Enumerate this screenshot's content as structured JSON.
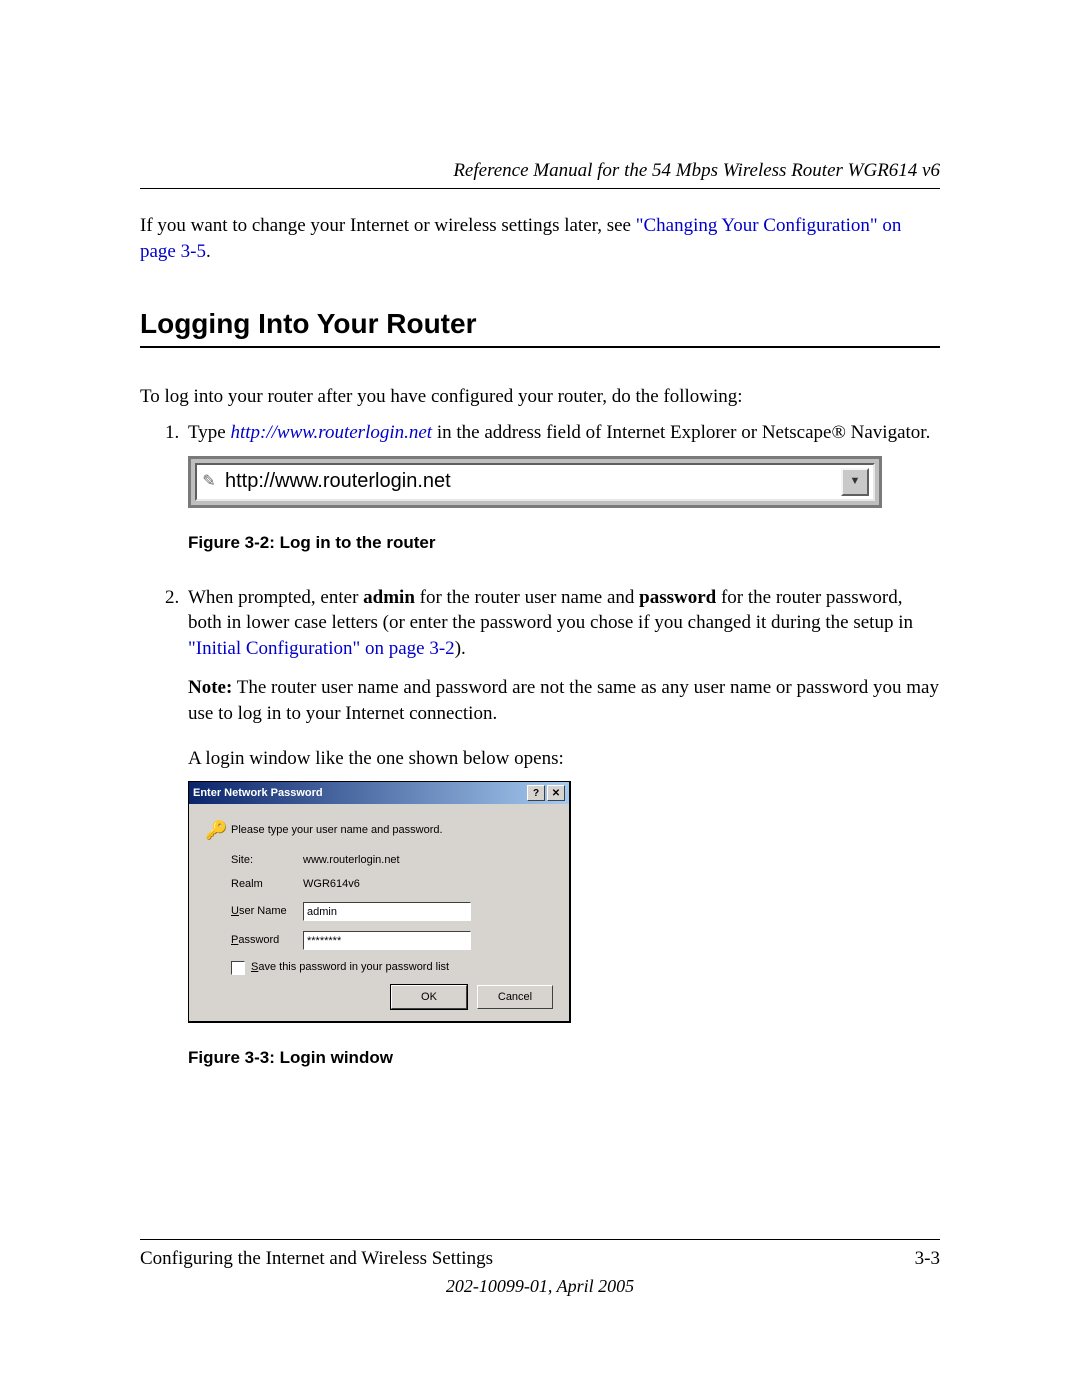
{
  "header": {
    "title": "Reference Manual for the 54 Mbps Wireless Router WGR614 v6"
  },
  "intro": {
    "pre": "If you want to change your Internet or wireless settings later, see ",
    "link": "\"Changing Your Configuration\" on page 3-5",
    "post": "."
  },
  "heading": "Logging Into Your Router",
  "lead": "To log into your router after you have configured your router, do the following:",
  "step1": {
    "pre": "Type ",
    "url": "http://www.routerlogin.net",
    "post": " in the address field of Internet Explorer or Netscape® Navigator."
  },
  "address_bar": {
    "text": "http://www.routerlogin.net"
  },
  "fig32_caption": "Figure 3-2:  Log in to the router",
  "step2": {
    "part1_pre": "When prompted, enter ",
    "bold1": "admin",
    "part1_mid": " for the router user name and ",
    "bold2": "password",
    "part1_post": " for the router password, both in lower case letters (or enter the password you chose if you changed it during the setup in ",
    "link": "\"Initial Configuration\" on page 3-2",
    "part1_end": ").",
    "note_label": "Note:",
    "note_text": " The router user name and password are not the same as any user name or password you may use to log in to your Internet connection.",
    "after_note": "A login window like the one shown below opens:"
  },
  "dialog": {
    "title": "Enter Network Password",
    "instruction": "Please type your user name and password.",
    "site_label": "Site:",
    "site_value": "www.routerlogin.net",
    "realm_label": "Realm",
    "realm_value": "WGR614v6",
    "username_label": "User Name",
    "username_value": "admin",
    "password_label": "Password",
    "password_value": "********",
    "save_label": "Save this password in your password list",
    "ok": "OK",
    "cancel": "Cancel"
  },
  "fig33_caption": "Figure 3-3:  Login window",
  "footer": {
    "left": "Configuring the Internet and Wireless Settings",
    "right": "3-3",
    "sub": "202-10099-01, April 2005"
  }
}
